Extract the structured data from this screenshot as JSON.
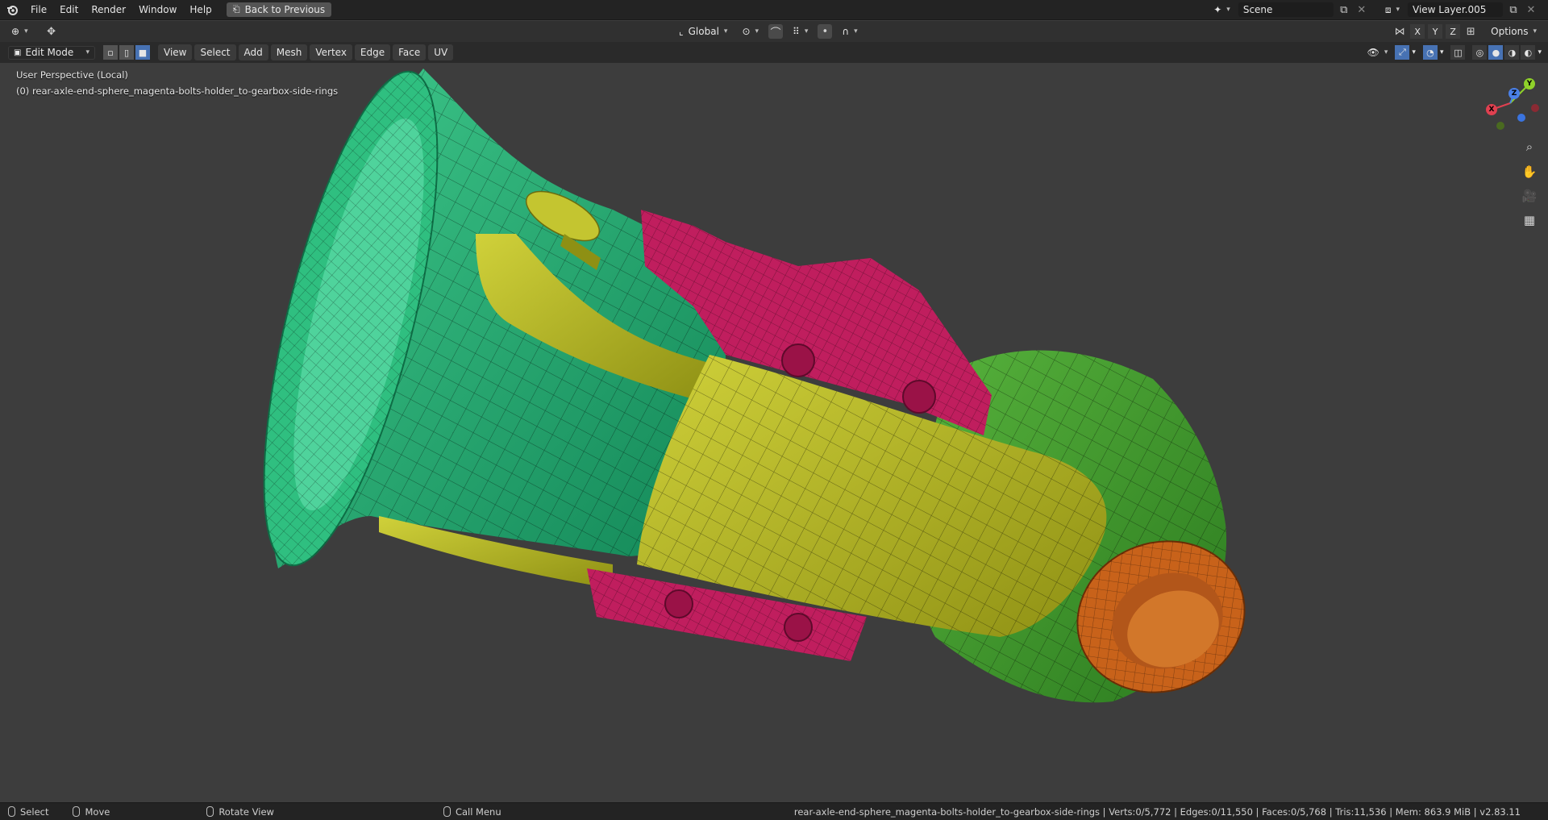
{
  "topbar": {
    "menus": [
      "File",
      "Edit",
      "Render",
      "Window",
      "Help"
    ],
    "back_button": "Back to Previous",
    "scene_name": "Scene",
    "view_layer": "View Layer.005"
  },
  "tool_header": {
    "orientation": "Global",
    "options_label": "Options",
    "axes": [
      "X",
      "Y",
      "Z"
    ]
  },
  "viewport_header": {
    "mode": "Edit Mode",
    "menus": [
      "View",
      "Select",
      "Add",
      "Mesh",
      "Vertex",
      "Edge",
      "Face",
      "UV"
    ]
  },
  "viewport": {
    "perspective": "User Perspective (Local)",
    "object_label": "(0) rear-axle-end-sphere_magenta-bolts-holder_to-gearbox-side-rings",
    "gizmo_axes": [
      "X",
      "Y",
      "Z"
    ],
    "colors": {
      "green": "#1fae74",
      "yellow": "#b8b822",
      "magenta": "#c01e5e",
      "orange": "#c8621a",
      "light_green": "#3e9d2f"
    }
  },
  "statusbar": {
    "select": "Select",
    "move": "Move",
    "rotate": "Rotate View",
    "call_menu": "Call Menu",
    "stats": "rear-axle-end-sphere_magenta-bolts-holder_to-gearbox-side-rings | Verts:0/5,772 | Edges:0/11,550 | Faces:0/5,768 | Tris:11,536 | Mem: 863.9 MiB | v2.83.11"
  }
}
